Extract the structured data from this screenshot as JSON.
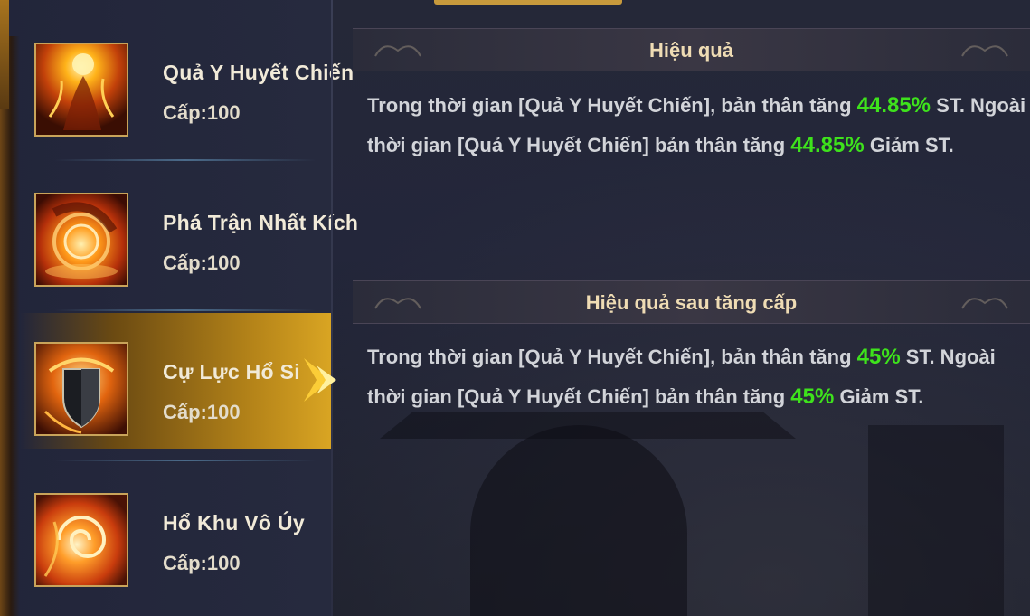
{
  "skills": [
    {
      "name": "Quả Y Huyết Chiến",
      "level": "Cấp:100"
    },
    {
      "name": "Phá Trận Nhất Kích",
      "level": "Cấp:100"
    },
    {
      "name": "Cự Lực Hổ Si",
      "level": "Cấp:100"
    },
    {
      "name": "Hổ Khu Vô Úy",
      "level": "Cấp:100"
    }
  ],
  "selected_skill_index": 2,
  "effect": {
    "title": "Hiệu quả",
    "line1_pre": "Trong thời gian [Quả Y Huyết Chiến], bản thân tăng ",
    "line1_value": "44.85%",
    "line1_post": " ST. Ngoài",
    "line2_pre": "thời gian [Quả Y Huyết Chiến] bản thân tăng ",
    "line2_value": "44.85%",
    "line2_post": " Giảm ST."
  },
  "upgrade_effect": {
    "title": "Hiệu quả sau tăng cấp",
    "line1_pre": "Trong thời gian [Quả Y Huyết Chiến], bản thân tăng ",
    "line1_value": "45%",
    "line1_post": " ST. Ngoài",
    "line2_pre": "thời gian [Quả Y Huyết Chiến] bản thân tăng ",
    "line2_value": "45%",
    "line2_post": " Giảm ST."
  },
  "colors": {
    "highlight_value": "#3ee21c",
    "selected_gold": "#d9a523",
    "title_text": "#efdcb4"
  },
  "icons": [
    "fire-aura-icon",
    "fire-vortex-icon",
    "shield-flame-icon",
    "flame-spiral-icon"
  ]
}
